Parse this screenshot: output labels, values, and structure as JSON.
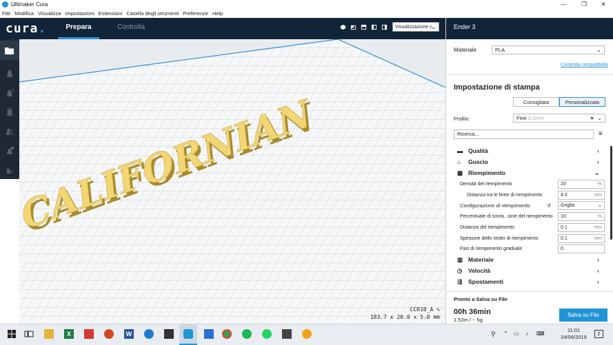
{
  "window": {
    "title": "Ultimaker Cura",
    "controls": [
      "—",
      "❐",
      "✕"
    ]
  },
  "menu": [
    "File",
    "Modifica",
    "Visualizza",
    "Impostazioni",
    "Estensioni",
    "Casella degli strumenti",
    "Preferenze",
    "Help"
  ],
  "header": {
    "logo": "cura",
    "tabs": {
      "prepare": "Prepara",
      "monitor": "Controlla"
    },
    "view_select": "Visualizzazione c..."
  },
  "viewport": {
    "model_text": "CALIFORNIAN",
    "model_color": "#f3d877",
    "object_name": "CCR10_A",
    "dimensions": "183.7 x 20.0 x 5.0 mm"
  },
  "panel": {
    "printer": "Ender 3",
    "material_label": "Materiale",
    "material_value": "PLA",
    "compat_link": "Controlla compatibilità",
    "print_setup_title": "Impostazione di stampa",
    "mode_recommended": "Consigliata",
    "mode_custom": "Personalizzata",
    "profile_label": "Profilo:",
    "profile_value": "Fine",
    "profile_hint": "0.1mm",
    "search_placeholder": "Ricerca...",
    "categories_top": [
      {
        "label": "Qualità",
        "icon": "quality-icon",
        "state": "collapsed"
      },
      {
        "label": "Guscio",
        "icon": "shell-icon",
        "state": "collapsed"
      },
      {
        "label": "Riempimento",
        "icon": "infill-icon",
        "state": "expanded"
      }
    ],
    "infill_settings": [
      {
        "label": "Densità del riempimento",
        "value": "20",
        "unit": "%",
        "indent": 0
      },
      {
        "label": "Distanza tra le linee di riempimento",
        "value": "4.0",
        "unit": "mm",
        "indent": 1
      },
      {
        "label": "Configurazione di riempimento",
        "value": "Griglia",
        "unit": "",
        "indent": 0,
        "select": true,
        "italic": true
      },
      {
        "label": "Percentuale di sovra...ione del riempimento",
        "value": "10",
        "unit": "%",
        "indent": 0
      },
      {
        "label": "Distanza del riempimento",
        "value": "0.1",
        "unit": "mm",
        "indent": 0
      },
      {
        "label": "Spessore dello strato di riempimento",
        "value": "0.1",
        "unit": "mm",
        "indent": 0
      },
      {
        "label": "Fasi di riempimento graduale",
        "value": "0",
        "unit": "",
        "indent": 0
      }
    ],
    "categories_bottom": [
      {
        "label": "Materiale",
        "icon": "material-icon"
      },
      {
        "label": "Velocità",
        "icon": "speed-icon"
      },
      {
        "label": "Spostamenti",
        "icon": "travel-icon"
      }
    ],
    "status": "Pronto a Salva su File",
    "time": "00h 36min",
    "usage": "1.53m / ~ 5g",
    "save_button": "Salva su File",
    "accent": "#2194d6"
  },
  "taskbar": {
    "time": "11:01",
    "date": "24/06/2019",
    "notif_count": "2"
  }
}
